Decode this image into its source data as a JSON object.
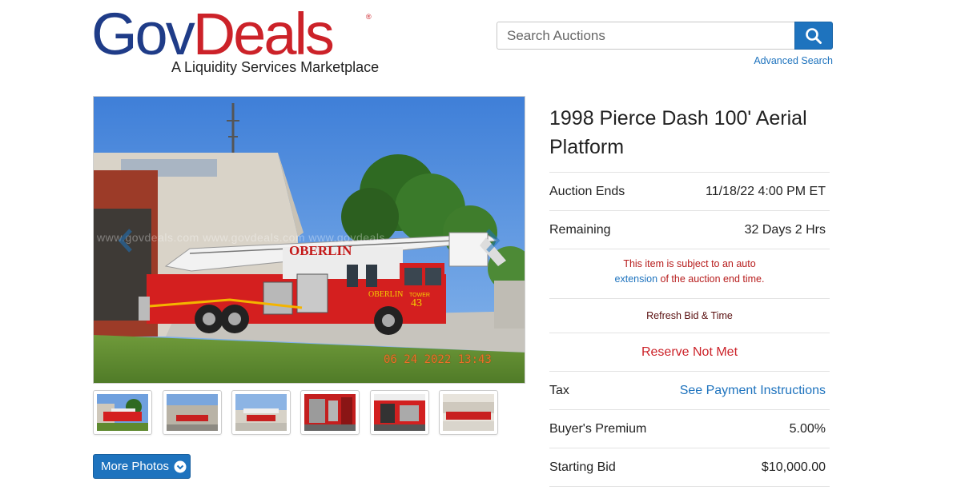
{
  "header": {
    "logo": {
      "gov": "Gov",
      "deals": "Deals",
      "registered": "®",
      "tagline": "A Liquidity Services Marketplace"
    },
    "search": {
      "placeholder": "Search Auctions",
      "button_icon": "search-icon"
    },
    "advanced_search": "Advanced Search"
  },
  "gallery": {
    "watermark": "www.govdeals.com   www.govdeals.com   www.govdeals",
    "truck_text": "OBERLIN",
    "truck_lower_text": "OBERLIN",
    "truck_unit": "TOWER",
    "truck_number": "43",
    "timestamp": "06 24 2022  13:43",
    "thumbnail_count": 6,
    "more_photos_label": "More Photos"
  },
  "listing": {
    "title": "1998 Pierce Dash 100' Aerial Platform",
    "auction_ends": {
      "label": "Auction Ends",
      "value": "11/18/22 4:00 PM ET"
    },
    "remaining": {
      "label": "Remaining",
      "value": "32 Days 2 Hrs"
    },
    "auto_extension": {
      "text1": "This item is subject to an auto",
      "link": "extension",
      "text2": " of the auction end time."
    },
    "refresh": "Refresh Bid & Time",
    "reserve": "Reserve Not Met",
    "tax": {
      "label": "Tax",
      "value": "See Payment Instructions"
    },
    "buyers_premium": {
      "label": "Buyer's Premium",
      "value": "5.00%"
    },
    "starting_bid": {
      "label": "Starting Bid",
      "value": "$10,000.00"
    }
  },
  "colors": {
    "brand_blue": "#1f3c88",
    "brand_red": "#cc2229",
    "link_blue": "#1e73be",
    "alert_red": "#b71c1c"
  }
}
